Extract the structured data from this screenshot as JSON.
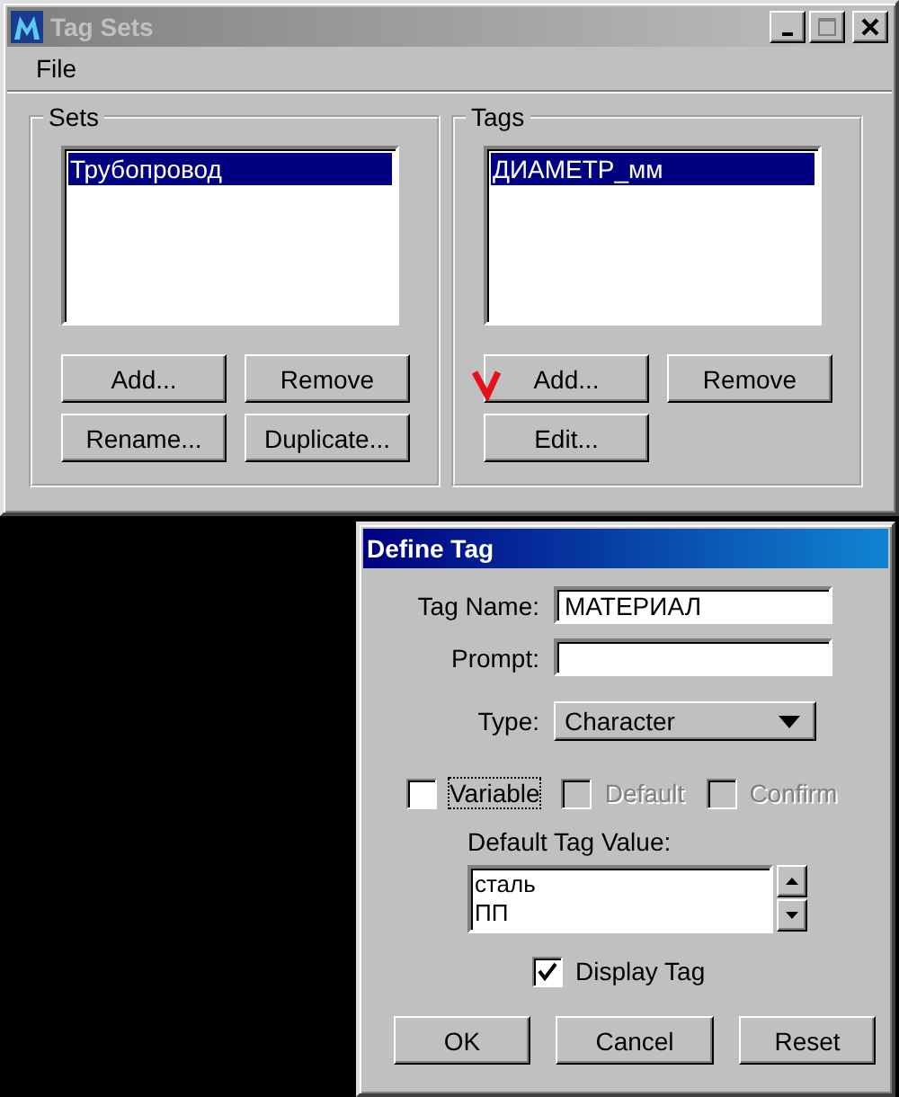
{
  "tag_sets_window": {
    "title": "Tag Sets",
    "active": false,
    "menu": [
      "File"
    ],
    "sets": {
      "label": "Sets",
      "items": [
        {
          "text": "Трубопровод",
          "selected": true
        }
      ],
      "buttons": [
        "Add...",
        "Remove",
        "Rename...",
        "Duplicate..."
      ]
    },
    "tags": {
      "label": "Tags",
      "items": [
        {
          "text": "ДИАМЕТР_мм",
          "selected": true
        }
      ],
      "buttons": [
        "Add...",
        "Remove",
        "Edit..."
      ]
    }
  },
  "define_tag_window": {
    "title": "Define Tag",
    "active": true,
    "tag_name": {
      "label": "Tag Name:",
      "value": "МАТЕРИАЛ"
    },
    "prompt": {
      "label": "Prompt:"
    },
    "type": {
      "label": "Type:",
      "value": "Character"
    },
    "options": [
      {
        "label": "Variable",
        "checked": false,
        "disabled": false,
        "focused": true
      },
      {
        "label": "Default",
        "checked": false,
        "disabled": true,
        "focused": false
      },
      {
        "label": "Confirm",
        "checked": false,
        "disabled": true,
        "focused": false
      }
    ],
    "default_value": {
      "label": "Default Tag Value:",
      "lines": [
        "сталь",
        "ПП"
      ]
    },
    "display_tag": {
      "label": "Display Tag",
      "checked": true
    },
    "buttons": [
      "OK",
      "Cancel",
      "Reset"
    ]
  }
}
